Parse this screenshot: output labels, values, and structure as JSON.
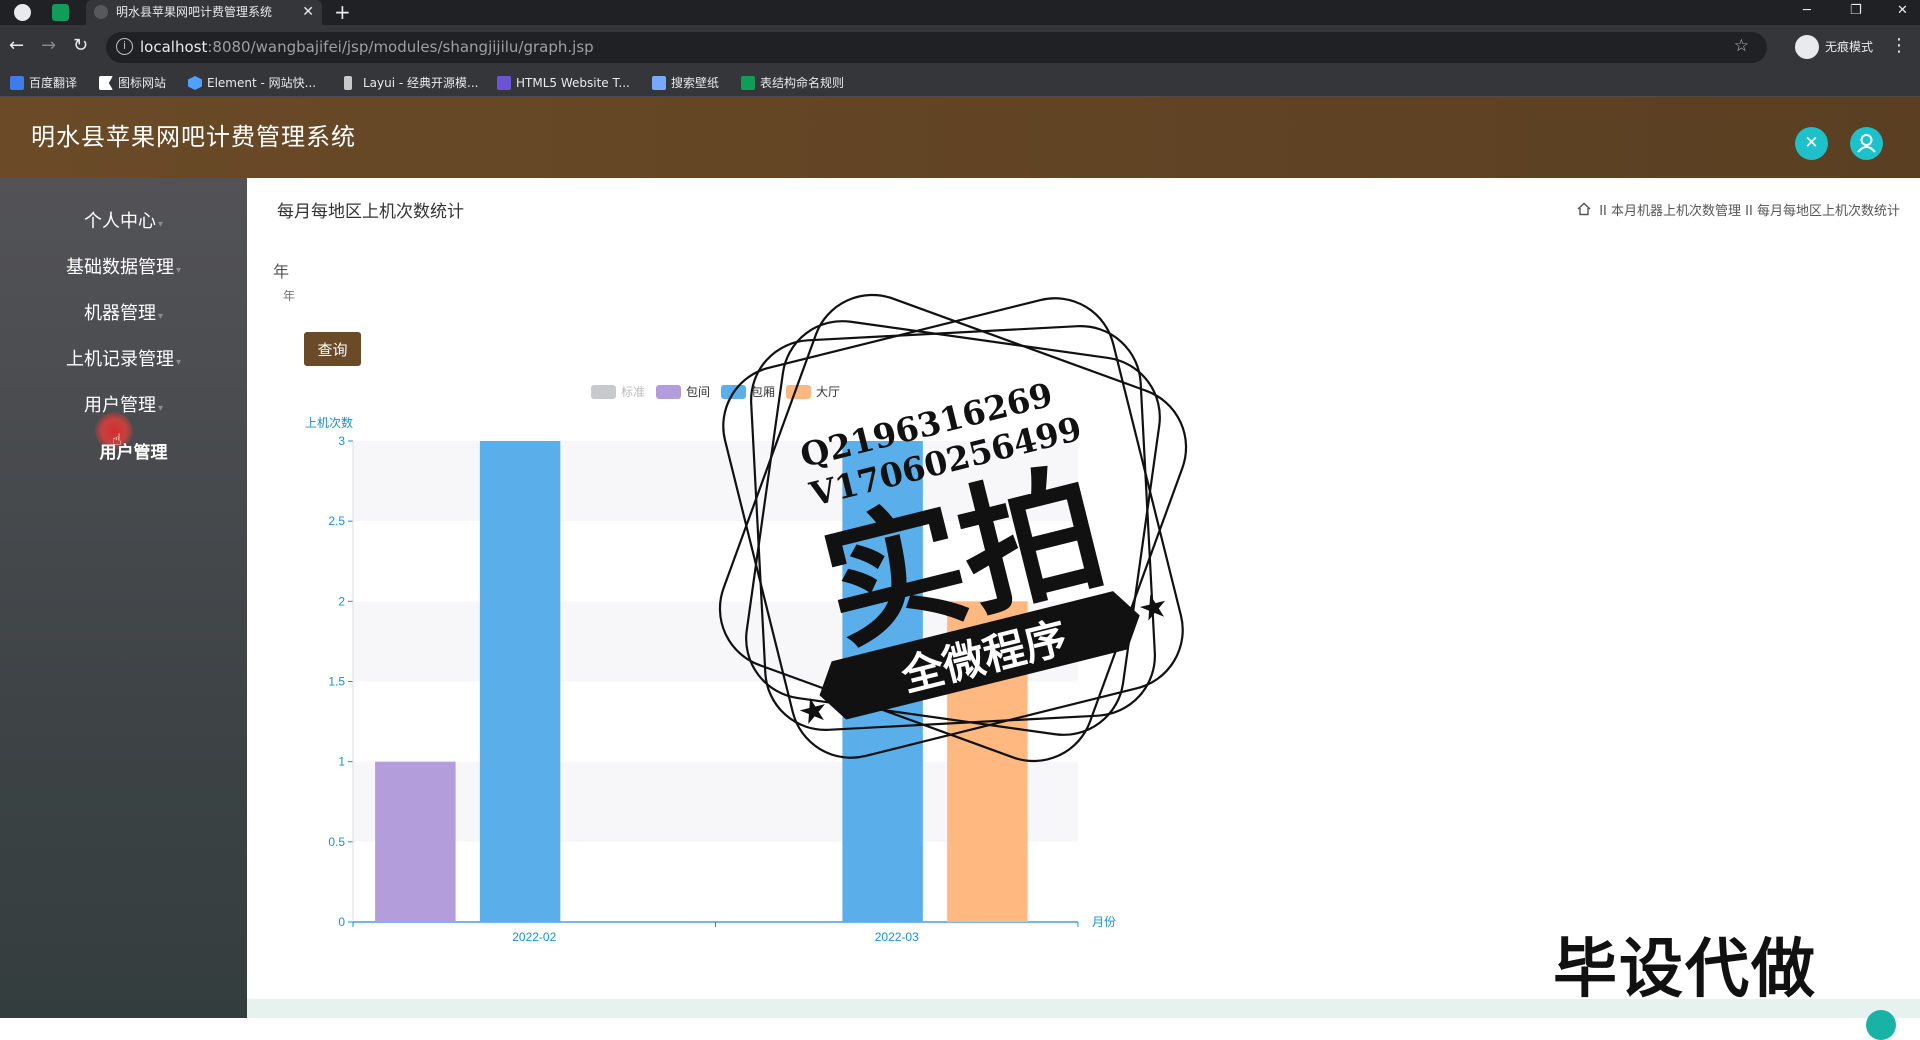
{
  "browser": {
    "tab_title": "明水县苹果网吧计费管理系统",
    "tab_close": "✕",
    "new_tab": "+",
    "url_host": "localhost",
    "url_rest": ":8080/wangbajifei/jsp/modules/shangjijilu/graph.jsp",
    "incognito_label": "无痕模式",
    "window_controls": [
      "─",
      "❐",
      "✕"
    ],
    "bookmarks": [
      {
        "label": "百度翻译",
        "color": "#3f7bea"
      },
      {
        "label": "图标网站",
        "color": "#ffffff"
      },
      {
        "label": "Element - 网站快...",
        "color": "#4ea2ff"
      },
      {
        "label": "Layui - 经典开源模...",
        "color": "#c9c9c9"
      },
      {
        "label": "HTML5 Website T...",
        "color": "#6d54d6"
      },
      {
        "label": "搜索壁纸",
        "color": "#7aa7ff"
      },
      {
        "label": "表结构命名规则",
        "color": "#0f9d58"
      }
    ]
  },
  "app": {
    "title": "明水县苹果网吧计费管理系统",
    "accent": "#6a4a27",
    "header_icons": [
      "fullscreen-icon",
      "user-icon"
    ]
  },
  "sidebar": {
    "items": [
      {
        "label": "个人中心"
      },
      {
        "label": "基础数据管理"
      },
      {
        "label": "机器管理"
      },
      {
        "label": "上机记录管理"
      },
      {
        "label": "用户管理"
      }
    ],
    "submenu_item": "用户管理"
  },
  "main": {
    "page_title": "每月每地区上机次数统计",
    "breadcrumb": [
      "本月机器上机次数管理",
      "每月每地区上机次数统计"
    ],
    "breadcrumb_sep": "II",
    "year_label": "年",
    "year_placeholder": "年",
    "query_button": "查询"
  },
  "chart_data": {
    "type": "bar",
    "categories": [
      "2022-02",
      "2022-03"
    ],
    "series": [
      {
        "name": "标准",
        "color": "#c7c9cc",
        "values": [
          0,
          0
        ]
      },
      {
        "name": "包间",
        "color": "#b39ddb",
        "values": [
          1,
          0
        ]
      },
      {
        "name": "包厢",
        "color": "#5aaeea",
        "values": [
          3,
          3
        ]
      },
      {
        "name": "大厅",
        "color": "#ffb980",
        "values": [
          0,
          2
        ]
      }
    ],
    "ylabel": "上机次数",
    "xlabel": "月份",
    "ylim": [
      0,
      3
    ],
    "yticks": [
      "0",
      "0.5",
      "1",
      "1.5",
      "2",
      "2.5",
      "3"
    ],
    "legend_position": "top-center",
    "grid": true
  },
  "watermarks": {
    "stamp_lines": [
      "Q2196316269",
      "V17060256499"
    ],
    "stamp_main": "实拍",
    "stamp_banner": "全微程序",
    "bottom_text": "毕设代做"
  }
}
